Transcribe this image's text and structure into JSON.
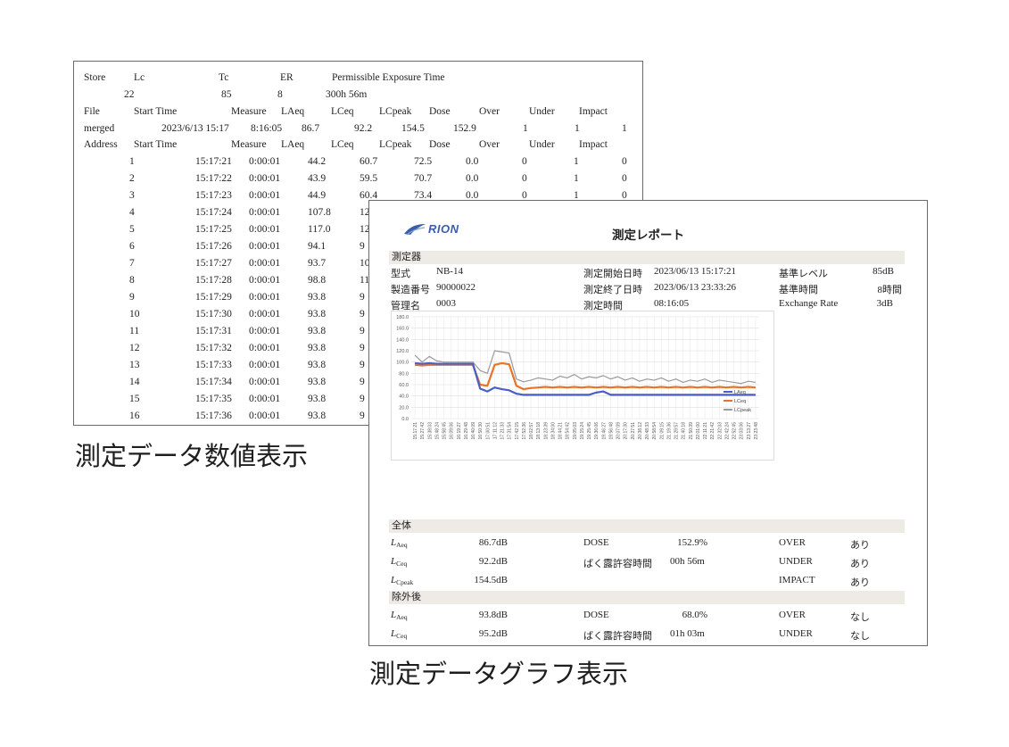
{
  "captions": {
    "data_view": "測定データ数値表示",
    "graph_view": "測定データグラフ表示"
  },
  "data_table": {
    "summary_headers": [
      "Store",
      "Lc",
      "Tc",
      "ER",
      "Permissible Exposure Time"
    ],
    "summary_values": [
      "22",
      "85",
      "8",
      "300h 56m"
    ],
    "file_headers": [
      "File",
      "Start Time",
      "Measure",
      "LAeq",
      "LCeq",
      "LCpeak",
      "Dose",
      "Over",
      "Under",
      "Impact"
    ],
    "file_row": [
      "merged",
      "2023/6/13 15:17",
      "8:16:05",
      "86.7",
      "92.2",
      "154.5",
      "152.9",
      "1",
      "1",
      "1"
    ],
    "address_headers": [
      "Address",
      "Start Time",
      "Measure",
      "LAeq",
      "LCeq",
      "LCpeak",
      "Dose",
      "Over",
      "Under",
      "Impact"
    ],
    "rows": [
      [
        "1",
        "15:17:21",
        "0:00:01",
        "44.2",
        "60.7",
        "72.5",
        "0.0",
        "0",
        "1",
        "0"
      ],
      [
        "2",
        "15:17:22",
        "0:00:01",
        "43.9",
        "59.5",
        "70.7",
        "0.0",
        "0",
        "1",
        "0"
      ],
      [
        "3",
        "15:17:23",
        "0:00:01",
        "44.9",
        "60.4",
        "73.4",
        "0.0",
        "0",
        "1",
        "0"
      ],
      [
        "4",
        "15:17:24",
        "0:00:01",
        "107.8",
        "12",
        "",
        "",
        "",
        "",
        ""
      ],
      [
        "5",
        "15:17:25",
        "0:00:01",
        "117.0",
        "12",
        "",
        "",
        "",
        "",
        ""
      ],
      [
        "6",
        "15:17:26",
        "0:00:01",
        "94.1",
        "9",
        "",
        "",
        "",
        "",
        ""
      ],
      [
        "7",
        "15:17:27",
        "0:00:01",
        "93.7",
        "10",
        "",
        "",
        "",
        "",
        ""
      ],
      [
        "8",
        "15:17:28",
        "0:00:01",
        "98.8",
        "11",
        "",
        "",
        "",
        "",
        ""
      ],
      [
        "9",
        "15:17:29",
        "0:00:01",
        "93.8",
        "9",
        "",
        "",
        "",
        "",
        ""
      ],
      [
        "10",
        "15:17:30",
        "0:00:01",
        "93.8",
        "9",
        "",
        "",
        "",
        "",
        ""
      ],
      [
        "11",
        "15:17:31",
        "0:00:01",
        "93.8",
        "9",
        "",
        "",
        "",
        "",
        ""
      ],
      [
        "12",
        "15:17:32",
        "0:00:01",
        "93.8",
        "9",
        "",
        "",
        "",
        "",
        ""
      ],
      [
        "13",
        "15:17:33",
        "0:00:01",
        "93.8",
        "9",
        "",
        "",
        "",
        "",
        ""
      ],
      [
        "14",
        "15:17:34",
        "0:00:01",
        "93.8",
        "9",
        "",
        "",
        "",
        "",
        ""
      ],
      [
        "15",
        "15:17:35",
        "0:00:01",
        "93.8",
        "9",
        "",
        "",
        "",
        "",
        ""
      ],
      [
        "16",
        "15:17:36",
        "0:00:01",
        "93.8",
        "9",
        "",
        "",
        "",
        "",
        ""
      ]
    ]
  },
  "report": {
    "logo": "RION",
    "title": "測定レポート",
    "device_section": "測定器",
    "device": {
      "model_label": "型式",
      "model": "NB-14",
      "serial_label": "製造番号",
      "serial": "90000022",
      "manage_label": "管理名",
      "manage": "0003",
      "start_label": "測定開始日時",
      "start": "2023/06/13 15:17:21",
      "end_label": "測定終了日時",
      "end": "2023/06/13 23:33:26",
      "duration_label": "測定時間",
      "duration": "08:16:05",
      "level_label": "基準レベル",
      "level": "85dB",
      "time_label": "基準時間",
      "time": "8時間",
      "er_label": "Exchange Rate",
      "er": "3dB"
    },
    "overall_section": "全体",
    "overall": {
      "laeq": "86.7dB",
      "lceq": "92.2dB",
      "lcpeak": "154.5dB",
      "dose_label": "DOSE",
      "dose": "152.9%",
      "pet_label": "ばく露許容時間",
      "pet": "00h 56m",
      "over_label": "OVER",
      "over": "あり",
      "under_label": "UNDER",
      "under": "あり",
      "impact_label": "IMPACT",
      "impact": "あり"
    },
    "excluded_section": "除外後",
    "excluded": {
      "laeq": "93.8dB",
      "lceq": "95.2dB",
      "dose_label": "DOSE",
      "dose": "68.0%",
      "pet_label": "ばく露許容時間",
      "pet": "01h 03m",
      "over_label": "OVER",
      "over": "なし",
      "under_label": "UNDER",
      "under": "なし"
    },
    "symbols": {
      "L": "L",
      "aeq": "Aeq",
      "ceq": "Ceq",
      "cpeak": "Cpeak"
    }
  },
  "chart_data": {
    "type": "line",
    "ylim": [
      0,
      180
    ],
    "yticks": [
      "0.0",
      "20.0",
      "40.0",
      "60.0",
      "80.0",
      "100.0",
      "120.0",
      "140.0",
      "160.0",
      "180.0"
    ],
    "x": [
      "15:17:21",
      "15:27:42",
      "15:38:03",
      "15:48:24",
      "15:58:45",
      "16:09:06",
      "16:19:27",
      "16:29:48",
      "16:40:09",
      "16:50:30",
      "17:00:51",
      "17:11:12",
      "17:21:33",
      "17:31:54",
      "17:42:15",
      "17:52:36",
      "18:02:57",
      "18:13:18",
      "18:23:39",
      "18:34:00",
      "18:44:21",
      "18:54:42",
      "19:05:03",
      "19:15:24",
      "19:25:45",
      "19:36:06",
      "19:46:27",
      "19:56:48",
      "20:07:09",
      "20:17:30",
      "20:27:51",
      "20:38:12",
      "20:48:33",
      "20:58:54",
      "21:09:15",
      "21:19:36",
      "21:29:57",
      "21:40:18",
      "21:50:39",
      "22:01:00",
      "22:11:21",
      "22:21:42",
      "22:32:03",
      "22:42:24",
      "22:52:45",
      "23:03:06",
      "23:13:27",
      "23:23:48"
    ],
    "series": [
      {
        "name": "LAeq",
        "color": "#4a5fc4",
        "values": [
          98,
          97,
          98,
          97,
          97,
          97,
          97,
          97,
          97,
          53,
          48,
          55,
          52,
          50,
          44,
          42,
          42,
          42,
          42,
          42,
          42,
          42,
          42,
          42,
          42,
          46,
          48,
          42,
          42,
          42,
          42,
          42,
          42,
          42,
          42,
          42,
          42,
          42,
          42,
          42,
          42,
          42,
          42,
          42,
          42,
          42,
          42,
          42
        ]
      },
      {
        "name": "LCeq",
        "color": "#e8742a",
        "values": [
          95,
          94,
          95,
          95,
          95,
          95,
          95,
          95,
          95,
          60,
          58,
          95,
          98,
          96,
          58,
          52,
          54,
          55,
          56,
          55,
          56,
          55,
          56,
          55,
          56,
          55,
          56,
          55,
          56,
          55,
          56,
          55,
          56,
          55,
          56,
          55,
          56,
          55,
          56,
          55,
          56,
          55,
          56,
          55,
          56,
          55,
          56,
          55
        ]
      },
      {
        "name": "LCpeak",
        "color": "#9a9a9a",
        "values": [
          112,
          100,
          110,
          102,
          100,
          100,
          100,
          100,
          100,
          85,
          80,
          120,
          118,
          116,
          70,
          65,
          68,
          72,
          70,
          68,
          75,
          72,
          78,
          70,
          74,
          72,
          76,
          70,
          74,
          68,
          72,
          66,
          70,
          68,
          72,
          66,
          70,
          64,
          68,
          66,
          70,
          64,
          68,
          66,
          64,
          62,
          66,
          64
        ]
      }
    ],
    "legend_position": "bottom-right",
    "grid": true
  }
}
